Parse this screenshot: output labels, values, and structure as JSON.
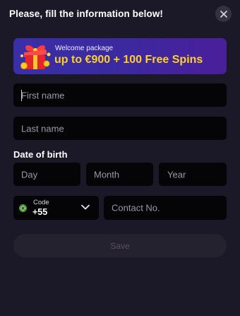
{
  "header": {
    "title": "Please, fill the information below!"
  },
  "banner": {
    "subtitle": "Welcome package",
    "title": "up to €900 + 100 Free Spins"
  },
  "form": {
    "first_name": {
      "placeholder": "First name",
      "value": ""
    },
    "last_name": {
      "placeholder": "Last name",
      "value": ""
    },
    "dob_label": "Date of birth",
    "day": {
      "placeholder": "Day"
    },
    "month": {
      "placeholder": "Month"
    },
    "year": {
      "placeholder": "Year"
    },
    "phone_code": {
      "label": "Code",
      "value": "+55"
    },
    "contact": {
      "placeholder": "Contact No."
    },
    "save_label": "Save"
  },
  "colors": {
    "background": "#1b1828",
    "field_bg": "#050407",
    "banner_accent": "#ffd02b",
    "banner_bg": "#3b2fa7",
    "disabled_button": "#25222f"
  },
  "icons": {
    "close": "close-icon",
    "gift": "gift-icon",
    "flag": "brazil-flag-icon",
    "chevron": "chevron-down-icon"
  }
}
